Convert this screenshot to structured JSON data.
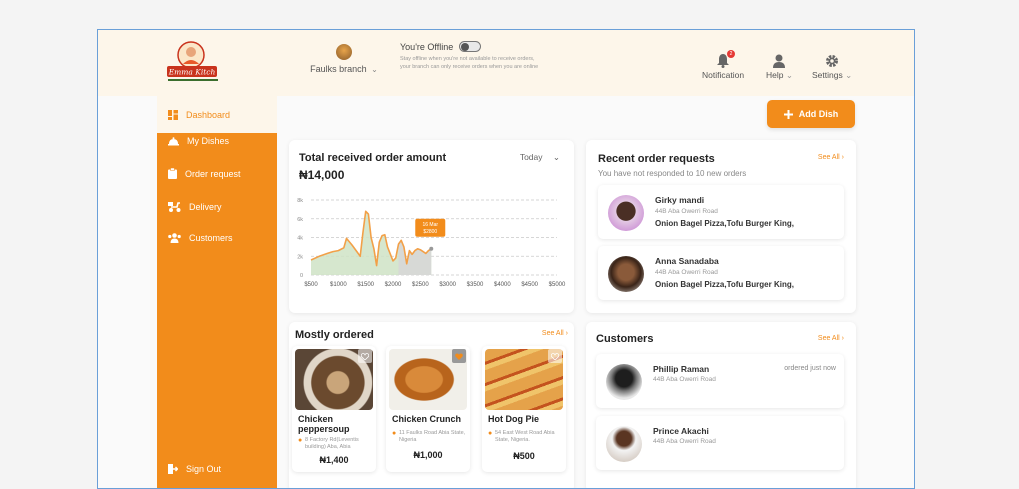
{
  "header": {
    "logo_text": "Emma Kitch",
    "branch_name": "Faulks branch",
    "offline_title": "You're Offline",
    "offline_desc_1": "Stay offline when you're not available to receive orders,",
    "offline_desc_2": "your branch can only receive orders when you are online",
    "notification_label": "Notification",
    "notification_count": "2",
    "help_label": "Help",
    "settings_label": "Settings"
  },
  "sidebar": {
    "items": [
      {
        "label": "Dashboard",
        "icon": "dashboard-icon"
      },
      {
        "label": "My Dishes",
        "icon": "cloche-icon"
      },
      {
        "label": "Order request",
        "icon": "clipboard-icon"
      },
      {
        "label": "Delivery",
        "icon": "scooter-icon"
      },
      {
        "label": "Customers",
        "icon": "people-icon"
      }
    ],
    "signout_label": "Sign Out"
  },
  "add_dish_label": "Add Dish",
  "chart_card": {
    "title": "Total received order amount",
    "amount": "₦14,000",
    "period": "Today",
    "tooltip_date": "16 Mar",
    "tooltip_value": "$2800"
  },
  "chart_data": {
    "type": "area",
    "x_tick_labels": [
      "$500",
      "$1000",
      "$1500",
      "$2000",
      "$2500",
      "$3000",
      "$3500",
      "$4000",
      "$4500",
      "$5000"
    ],
    "y_tick_labels": [
      "8k",
      "6k",
      "4k",
      "2k",
      "0"
    ],
    "ylim": [
      0,
      8000
    ],
    "x": [
      500,
      650,
      800,
      900,
      1000,
      1100,
      1150,
      1250,
      1350,
      1400,
      1450,
      1500,
      1550,
      1600,
      1650,
      1700,
      1750,
      1800,
      1850,
      1900,
      2000,
      2050,
      2100,
      2150,
      2200,
      2250,
      2300,
      2350,
      2400,
      2450,
      2500,
      2600,
      2650,
      2700
    ],
    "y": [
      1600,
      2000,
      2300,
      2500,
      2600,
      2900,
      3900,
      3200,
      2400,
      2000,
      4500,
      6800,
      6500,
      4000,
      2800,
      1000,
      3500,
      4200,
      4300,
      3000,
      1500,
      1800,
      3300,
      3700,
      3000,
      1200,
      2600,
      2200,
      2600,
      2800,
      2700,
      2300,
      2600,
      2800
    ],
    "highlight": {
      "x": 2700,
      "y": 2800
    },
    "grid": true,
    "colors": {
      "line": "#f2a048",
      "fill": "#cfe3c6",
      "highlight_fill": "#d7d7d7"
    }
  },
  "recent_orders": {
    "title": "Recent order requests",
    "see_all": "See All",
    "subtitle": "You have not responded to 10 new orders",
    "items": [
      {
        "name": "Girky mandi",
        "address": "44B Aba Owerri Road",
        "items": "Onion Bagel Pizza,Tofu Burger King,"
      },
      {
        "name": "Anna Sanadaba",
        "address": "44B Aba Owerri Road",
        "items": "Onion Bagel Pizza,Tofu Burger King,"
      }
    ]
  },
  "mostly_ordered": {
    "title": "Mostly ordered",
    "see_all": "See All",
    "dishes": [
      {
        "name": "Chicken peppersoup",
        "address": "8 Factory Rd(Leventis building) Aba, Abia",
        "price": "₦1,400"
      },
      {
        "name": "Chicken Crunch",
        "address": "11 Faulks Road Abia State, Nigeria",
        "price": "₦1,000"
      },
      {
        "name": "Hot Dog Pie",
        "address": "54 East West Road Abia State, Nigeria.",
        "price": "₦500"
      }
    ]
  },
  "customers": {
    "title": "Customers",
    "see_all": "See All",
    "items": [
      {
        "name": "Phillip  Raman",
        "address": "44B Aba Owerri Road",
        "time": "ordered just now"
      },
      {
        "name": "Prince Akachi",
        "address": "44B Aba Owerri Road",
        "time": ""
      }
    ]
  },
  "colors": {
    "accent": "#f28c1b",
    "topbar": "#fdf6ea"
  }
}
